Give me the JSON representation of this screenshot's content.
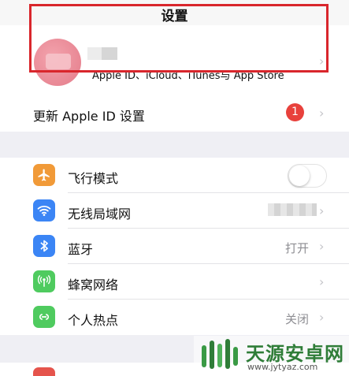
{
  "nav": {
    "title": "设置"
  },
  "profile": {
    "subtitle": "Apple ID、iCloud、iTunes与 App Store"
  },
  "update": {
    "label": "更新 Apple ID 设置",
    "badge": "1"
  },
  "settings": {
    "airplane": {
      "label": "飞行模式",
      "icon": "airplane-icon",
      "color": "#f19a38",
      "enabled": false
    },
    "wifi": {
      "label": "无线局域网",
      "icon": "wifi-icon",
      "color": "#3b85f5"
    },
    "bluetooth": {
      "label": "蓝牙",
      "icon": "bluetooth-icon",
      "color": "#3b85f5",
      "value": "打开"
    },
    "cellular": {
      "label": "蜂窝网络",
      "icon": "antenna-icon",
      "color": "#4fcb5f"
    },
    "hotspot": {
      "label": "个人热点",
      "icon": "hotspot-icon",
      "color": "#4fcb5f",
      "value": "关闭"
    }
  },
  "watermark": {
    "text": "天源安卓网",
    "url": "www.jytyaz.com"
  },
  "colors": {
    "badge": "#e8413c",
    "highlight": "#d9262c",
    "background": "#efeff4"
  }
}
